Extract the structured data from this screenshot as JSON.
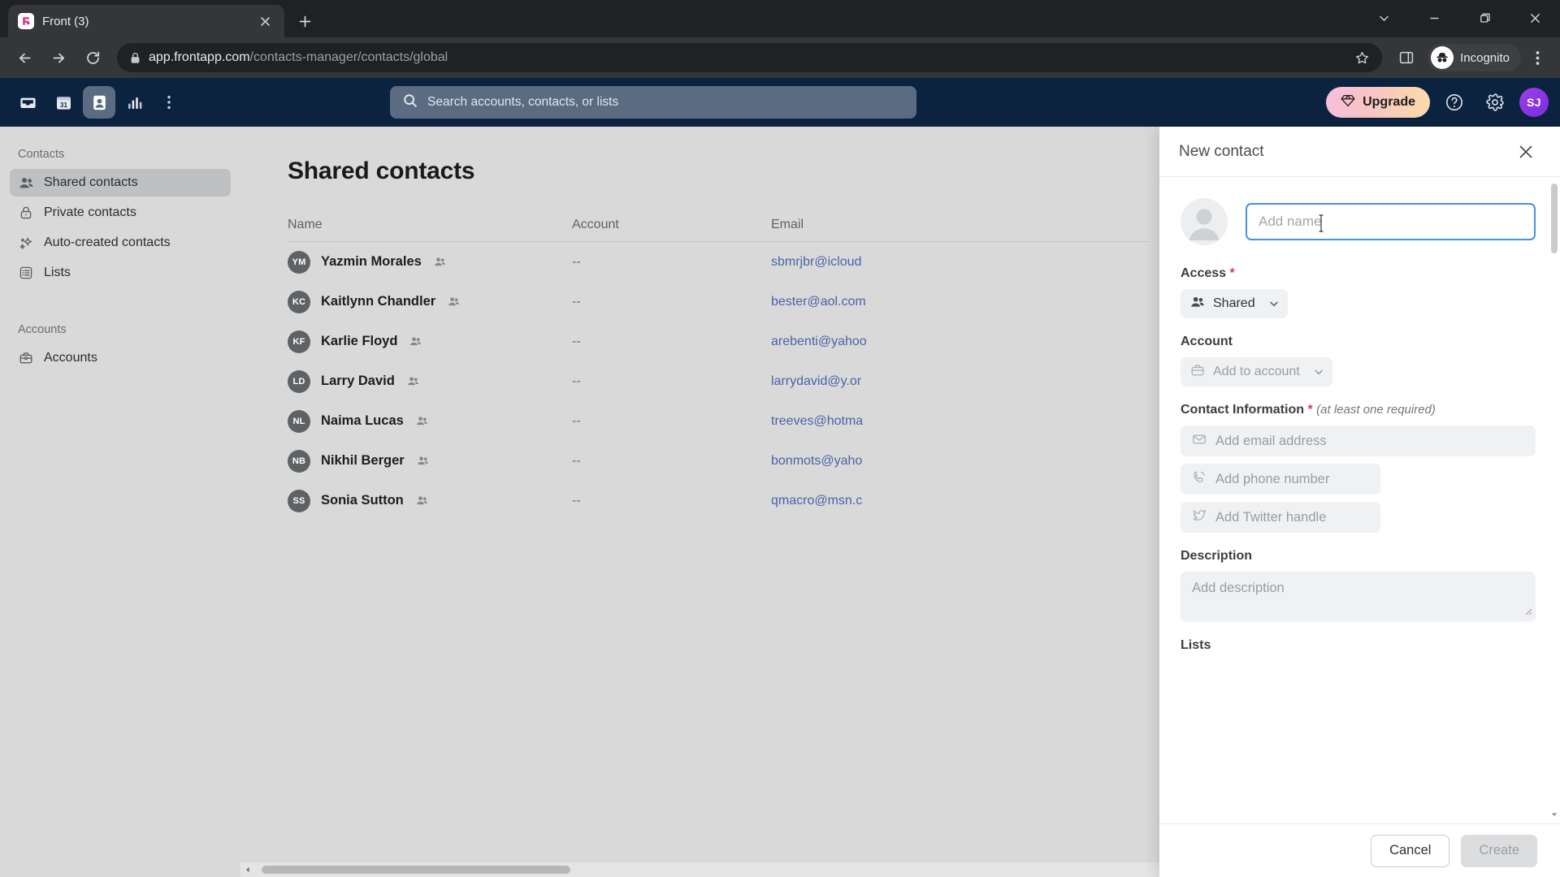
{
  "browser": {
    "tab": {
      "title": "Front (3)",
      "favicon": "front-logo-icon",
      "close": "close-tab-icon"
    },
    "new_tab_tooltip": "New tab",
    "window_controls": {
      "minimize": "minimize-icon",
      "maximize": "maximize-icon",
      "close": "close-window-icon",
      "chevron": "chevron-down-icon"
    },
    "nav": {
      "back": "back-arrow-icon",
      "forward": "forward-arrow-icon",
      "reload": "reload-icon"
    },
    "omnibox": {
      "lock": "lock-icon",
      "domain": "app.frontapp.com",
      "path": "/contacts-manager/contacts/global",
      "star": "bookmark-star-icon"
    },
    "sidepanel_icon": "side-panel-icon",
    "profile": {
      "label": "Incognito",
      "icon": "incognito-icon"
    },
    "menu": "three-dot-menu-icon"
  },
  "topnav": {
    "icons": [
      {
        "name": "inbox",
        "active": false
      },
      {
        "name": "calendar",
        "active": false
      },
      {
        "name": "contacts",
        "active": true
      },
      {
        "name": "analytics",
        "active": false
      }
    ],
    "more": "more-vertical-icon",
    "search": {
      "placeholder": "Search accounts, contacts, or lists",
      "icon": "search-icon"
    },
    "upgrade": {
      "label": "Upgrade",
      "icon": "diamond-icon"
    },
    "help": "help-circle-icon",
    "settings": "gear-icon",
    "avatar": {
      "initials": "SJ",
      "color": "#8A34E0"
    }
  },
  "sidebar": {
    "groups": [
      {
        "title": "Contacts",
        "items": [
          {
            "label": "Shared contacts",
            "icon": "people-icon",
            "selected": true
          },
          {
            "label": "Private contacts",
            "icon": "lock-icon",
            "selected": false
          },
          {
            "label": "Auto-created contacts",
            "icon": "sparkle-icon",
            "selected": false
          },
          {
            "label": "Lists",
            "icon": "list-icon",
            "selected": false
          }
        ]
      },
      {
        "title": "Accounts",
        "items": [
          {
            "label": "Accounts",
            "icon": "briefcase-icon",
            "selected": false
          }
        ]
      }
    ]
  },
  "main": {
    "title": "Shared contacts",
    "columns": {
      "name": "Name",
      "account": "Account",
      "email": "Email"
    },
    "rows": [
      {
        "initials": "YM",
        "name": "Yazmin Morales",
        "shared_icon": "people-icon",
        "account": "--",
        "email": "sbmrjbr@icloud"
      },
      {
        "initials": "KC",
        "name": "Kaitlynn Chandler",
        "shared_icon": "people-icon",
        "account": "--",
        "email": "bester@aol.com"
      },
      {
        "initials": "KF",
        "name": "Karlie Floyd",
        "shared_icon": "people-icon",
        "account": "--",
        "email": "arebenti@yahoo"
      },
      {
        "initials": "LD",
        "name": "Larry David",
        "shared_icon": "people-icon",
        "account": "--",
        "email": "larrydavid@y.or"
      },
      {
        "initials": "NL",
        "name": "Naima Lucas",
        "shared_icon": "people-icon",
        "account": "--",
        "email": "treeves@hotma"
      },
      {
        "initials": "NB",
        "name": "Nikhil Berger",
        "shared_icon": "people-icon",
        "account": "--",
        "email": "bonmots@yaho"
      },
      {
        "initials": "SS",
        "name": "Sonia Sutton",
        "shared_icon": "people-icon",
        "account": "--",
        "email": "qmacro@msn.c"
      }
    ]
  },
  "panel": {
    "title": "New contact",
    "close_icon": "close-icon",
    "avatar_icon": "person-placeholder-icon",
    "name_placeholder": "Add name",
    "name_value": "",
    "access": {
      "label": "Access",
      "required": "*",
      "value": "Shared",
      "icon": "people-icon",
      "chevron": "chevron-down-icon"
    },
    "account": {
      "label": "Account",
      "placeholder": "Add to account",
      "icon": "briefcase-icon",
      "chevron": "chevron-down-icon"
    },
    "contact_information": {
      "label": "Contact Information",
      "required": "*",
      "hint": "(at least one required)"
    },
    "fields": [
      {
        "placeholder": "Add email address",
        "icon": "envelope-icon",
        "width": "full"
      },
      {
        "placeholder": "Add phone number",
        "icon": "phone-icon",
        "width": "phone"
      },
      {
        "placeholder": "Add Twitter handle",
        "icon": "twitter-icon",
        "width": "twitter"
      }
    ],
    "description": {
      "label": "Description",
      "placeholder": "Add description"
    },
    "lists_label": "Lists",
    "footer": {
      "cancel": "Cancel",
      "create": "Create"
    }
  }
}
